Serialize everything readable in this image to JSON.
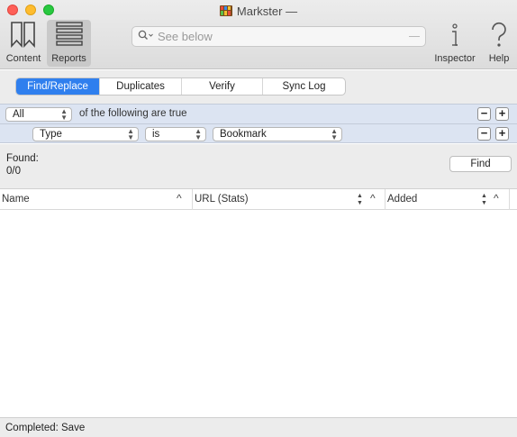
{
  "window": {
    "title": "Markster —"
  },
  "toolbar": {
    "content_label": "Content",
    "reports_label": "Reports",
    "inspector_label": "Inspector",
    "help_label": "Help",
    "search_placeholder": "See below"
  },
  "tabs": [
    {
      "label": "Find/Replace",
      "active": true
    },
    {
      "label": "Duplicates",
      "active": false
    },
    {
      "label": "Verify",
      "active": false
    },
    {
      "label": "Sync Log",
      "active": false
    }
  ],
  "rules": {
    "match_popup": "All",
    "match_text": "of the following are true",
    "criterion": {
      "field": "Type",
      "operator": "is",
      "value": "Bookmark"
    },
    "minus": "−",
    "plus": "+"
  },
  "found": {
    "label": "Found:",
    "value": "0/0",
    "find_button": "Find"
  },
  "table": {
    "columns": [
      {
        "label": "Name",
        "sort": "^"
      },
      {
        "label": "URL (Stats)",
        "sort": "^"
      },
      {
        "label": "Added",
        "sort": "^"
      }
    ],
    "rows": []
  },
  "status": {
    "text": "Completed: Save"
  },
  "colors": {
    "accent": "#2f7fee",
    "rule_row": "#dce4f2",
    "chrome": "#ececec"
  }
}
